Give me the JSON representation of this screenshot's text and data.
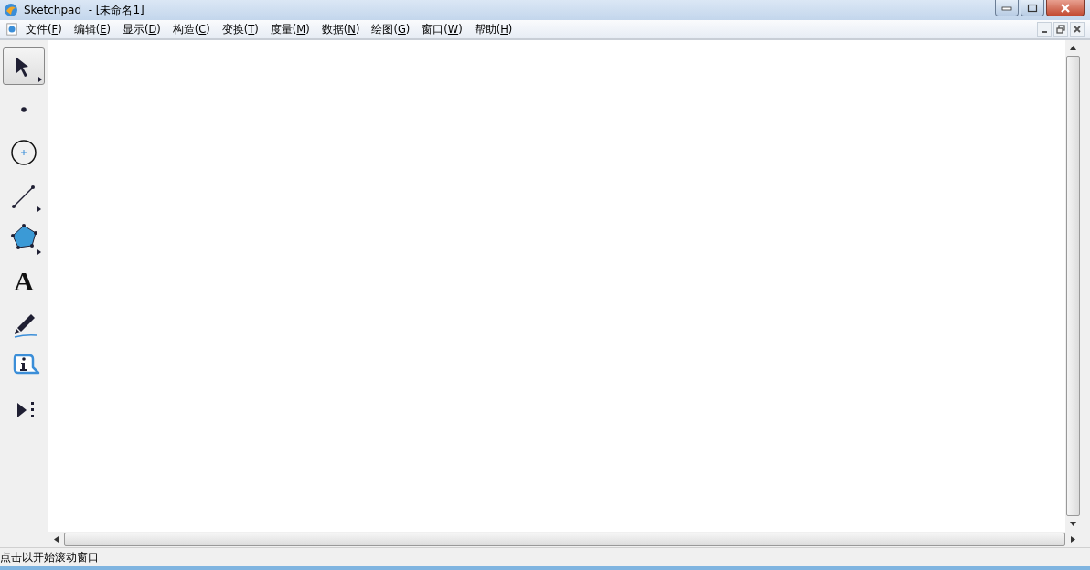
{
  "window": {
    "title": "Sketchpad  - [未命名1]"
  },
  "menu": [
    "文件(F)",
    "编辑(E)",
    "显示(D)",
    "构造(C)",
    "变换(T)",
    "度量(M)",
    "数据(N)",
    "绘图(G)",
    "窗口(W)",
    "帮助(H)"
  ],
  "tools": [
    {
      "kind": "arrow",
      "selected": true
    },
    {
      "kind": "point",
      "selected": false
    },
    {
      "kind": "compass",
      "selected": false
    },
    {
      "kind": "line",
      "selected": false
    },
    {
      "kind": "polygon",
      "selected": false
    },
    {
      "kind": "text",
      "glyph": "A",
      "selected": false
    },
    {
      "kind": "marker",
      "selected": false
    },
    {
      "kind": "info",
      "selected": false
    },
    {
      "kind": "custom",
      "selected": false
    }
  ],
  "status_bar": "点击以开始滚动窗口"
}
